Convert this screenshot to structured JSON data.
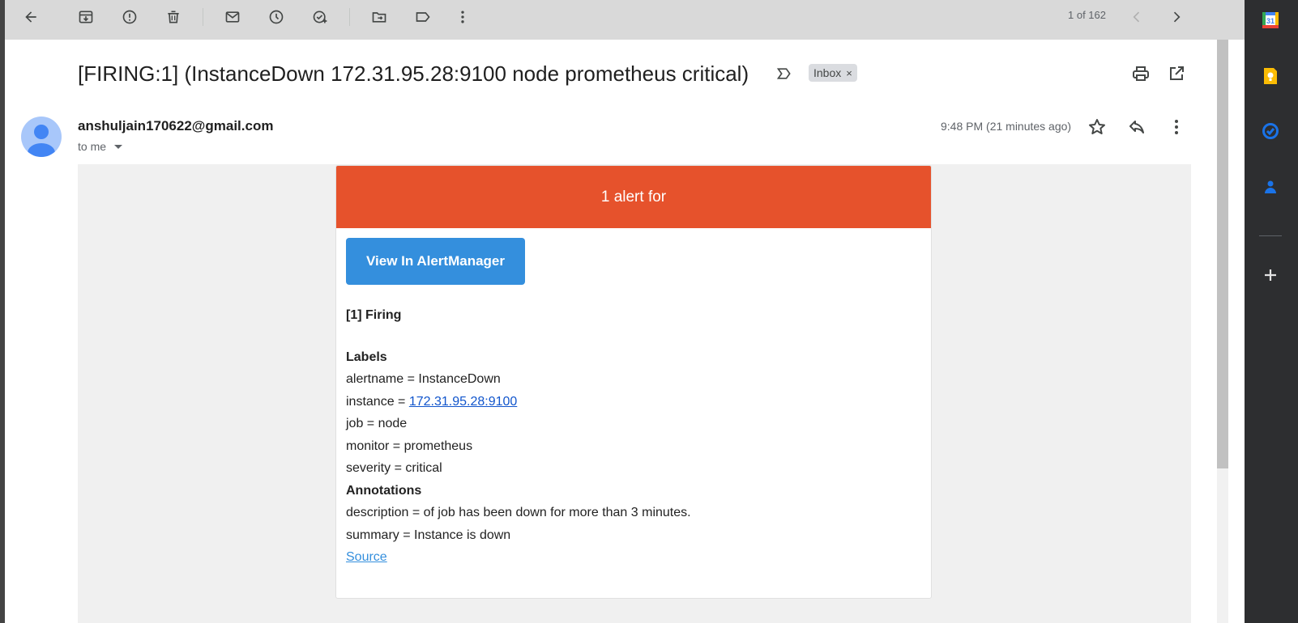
{
  "toolbar": {
    "pager_text": "1 of 162",
    "icons": [
      "back-icon",
      "archive-icon",
      "report-spam-icon",
      "delete-icon",
      "mark-unread-icon",
      "snooze-icon",
      "add-task-icon",
      "move-to-icon",
      "label-icon",
      "more-icon",
      "older-icon",
      "newer-icon"
    ]
  },
  "email": {
    "subject": "[FIRING:1] (InstanceDown 172.31.95.28:9100 node prometheus critical)",
    "label_chip": "Inbox",
    "label_remove": "×",
    "sender": "anshuljain170622@gmail.com",
    "recipient": "to me",
    "time": "9:48 PM (21 minutes ago)"
  },
  "alert": {
    "banner": "1 alert for",
    "button_label": "View In AlertManager",
    "firing_heading": "[1] Firing",
    "labels_heading": "Labels",
    "labels": [
      "alertname = InstanceDown",
      "instance = ",
      "job = node",
      "monitor = prometheus",
      "severity = critical"
    ],
    "instance_link": "172.31.95.28:9100",
    "annotations_heading": "Annotations",
    "annotations": [
      "description = of job has been down for more than 3 minutes.",
      "summary = Instance is down"
    ],
    "source_link": "Source"
  },
  "colors": {
    "banner": "#e6522c",
    "button": "#348fdd",
    "link": "#1155cc"
  },
  "sidebar": {
    "calendar_label": "31",
    "apps": [
      "calendar-icon",
      "keep-icon",
      "tasks-icon",
      "contacts-icon",
      "add-icon"
    ]
  }
}
